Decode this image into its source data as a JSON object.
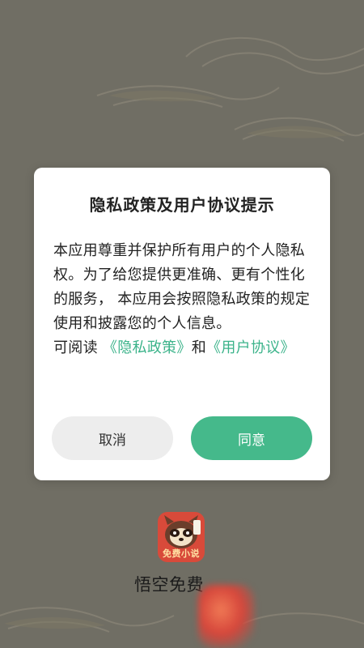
{
  "dialog": {
    "title": "隐私政策及用户协议提示",
    "body_text": "本应用尊重并保护所有用户的个人隐私权。为了给您提供更准确、更有个性化的服务， 本应用会按照隐私政策的规定使用和披露您的个人信息。",
    "read_prefix": "可阅读 ",
    "privacy_link": "《隐私政策》",
    "and_text": "和",
    "agreement_link": "《用户协议》",
    "cancel_label": "取消",
    "agree_label": "同意"
  },
  "app": {
    "logo_text": "免费小说",
    "name": "悟空免费"
  },
  "colors": {
    "accent": "#45b98b",
    "link": "#3bb38a",
    "cancel_bg": "#ededed",
    "background": "#7c7a70"
  }
}
